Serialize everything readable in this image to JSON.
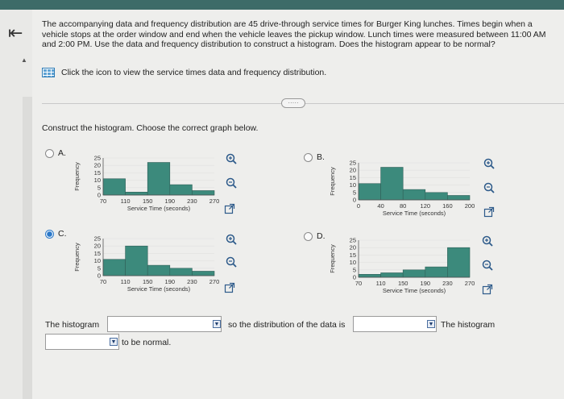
{
  "question": {
    "text": "The accompanying data and frequency distribution are 45 drive-through service times for Burger King lunches. Times begin when a vehicle stops at the order window and end when the vehicle leaves the pickup window. Lunch times were measured between 11:00 AM and 2:00 PM. Use the data and frequency distribution to construct a histogram. Does the histogram appear to be normal?"
  },
  "data_link": {
    "label": "Click the icon to view the service times data and frequency distribution."
  },
  "more_label": "·····",
  "instruction": "Construct the histogram. Choose the correct graph below.",
  "icons": {
    "back": "back-arrow-icon",
    "data": "table-grid-icon",
    "zoom_in": "zoom-in-icon",
    "zoom_out": "zoom-out-icon",
    "popout": "popout-icon"
  },
  "colors": {
    "bar": "#3c8a7c",
    "selected_radio": "#2a78c8",
    "topbar": "#3d6b68"
  },
  "options": [
    {
      "id": "A",
      "label": "A.",
      "selected": false
    },
    {
      "id": "B",
      "label": "B.",
      "selected": false
    },
    {
      "id": "C",
      "label": "C.",
      "selected": true
    },
    {
      "id": "D",
      "label": "D.",
      "selected": false
    }
  ],
  "chart_data": [
    {
      "type": "bar",
      "option": "A",
      "xlabel": "Service Time (seconds)",
      "ylabel": "Frequency",
      "x_ticks": [
        "70",
        "110",
        "150",
        "190",
        "230",
        "270"
      ],
      "y_ticks": [
        "0",
        "5",
        "10",
        "15",
        "20",
        "25"
      ],
      "bins": [
        [
          70,
          110
        ],
        [
          110,
          150
        ],
        [
          150,
          190
        ],
        [
          190,
          230
        ],
        [
          230,
          270
        ]
      ],
      "values": [
        11,
        2,
        22,
        7,
        3
      ],
      "ylim": [
        0,
        25
      ]
    },
    {
      "type": "bar",
      "option": "B",
      "xlabel": "Service Time (seconds)",
      "ylabel": "Frequency",
      "x_ticks": [
        "0",
        "40",
        "80",
        "120",
        "160",
        "200"
      ],
      "y_ticks": [
        "0",
        "5",
        "10",
        "15",
        "20",
        "25"
      ],
      "bins": [
        [
          0,
          40
        ],
        [
          40,
          80
        ],
        [
          80,
          120
        ],
        [
          120,
          160
        ],
        [
          160,
          200
        ]
      ],
      "values": [
        11,
        22,
        7,
        5,
        3
      ],
      "ylim": [
        0,
        25
      ]
    },
    {
      "type": "bar",
      "option": "C",
      "xlabel": "Service Time (seconds)",
      "ylabel": "Frequency",
      "x_ticks": [
        "70",
        "110",
        "150",
        "190",
        "230",
        "270"
      ],
      "y_ticks": [
        "0",
        "5",
        "10",
        "15",
        "20",
        "25"
      ],
      "bins": [
        [
          70,
          110
        ],
        [
          110,
          150
        ],
        [
          150,
          190
        ],
        [
          190,
          230
        ],
        [
          230,
          270
        ]
      ],
      "values": [
        11,
        20,
        7,
        5,
        3
      ],
      "ylim": [
        0,
        25
      ]
    },
    {
      "type": "bar",
      "option": "D",
      "xlabel": "Service Time (seconds)",
      "ylabel": "Frequency",
      "x_ticks": [
        "70",
        "110",
        "150",
        "190",
        "230",
        "270"
      ],
      "y_ticks": [
        "0",
        "5",
        "10",
        "15",
        "20",
        "25"
      ],
      "bins": [
        [
          70,
          110
        ],
        [
          110,
          150
        ],
        [
          150,
          190
        ],
        [
          190,
          230
        ],
        [
          230,
          270
        ]
      ],
      "values": [
        2,
        3,
        5,
        7,
        20
      ],
      "ylim": [
        0,
        25
      ]
    }
  ],
  "answer": {
    "part1_prefix": "The histogram",
    "part1_suffix": "so the distribution of the data is",
    "part2_prefix": "The histogram",
    "part2_suffix": "to be normal.",
    "dropdown1_value": "",
    "dropdown2_value": "",
    "dropdown3_value": ""
  }
}
